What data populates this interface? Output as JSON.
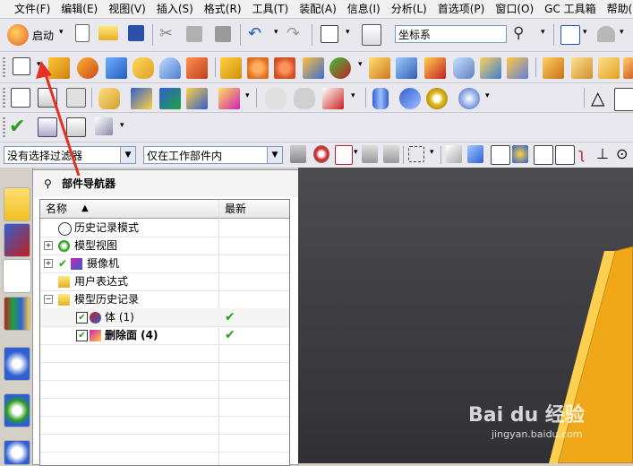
{
  "menu": {
    "items": [
      "文件(F)",
      "编辑(E)",
      "视图(V)",
      "插入(S)",
      "格式(R)",
      "工具(T)",
      "装配(A)",
      "信息(I)",
      "分析(L)",
      "首选项(P)",
      "窗口(O)",
      "GC 工具箱",
      "帮助(H)"
    ]
  },
  "toolbar1": {
    "start_label": "启动",
    "wcs_value": "坐标系"
  },
  "filter_bar": {
    "selection_filter": "没有选择过滤器",
    "scope": "仅在工作部件内"
  },
  "navigator": {
    "title": "部件导航器",
    "col_name": "名称",
    "col_latest": "最新",
    "rows": [
      {
        "label": "历史记录模式"
      },
      {
        "label": "模型视图"
      },
      {
        "label": "摄像机"
      },
      {
        "label": "用户表达式"
      },
      {
        "label": "模型历史记录"
      },
      {
        "label": "体 (1)",
        "latest": "✔"
      },
      {
        "label": "删除面 (4)",
        "latest": "✔"
      }
    ]
  },
  "watermark": {
    "brand": "Bai du 经验",
    "url": "jingyan.baidu.com"
  },
  "colors": {
    "accent_orange": "#f0a818",
    "check_green": "#2a9d1e",
    "arrow_red": "#e63020"
  }
}
